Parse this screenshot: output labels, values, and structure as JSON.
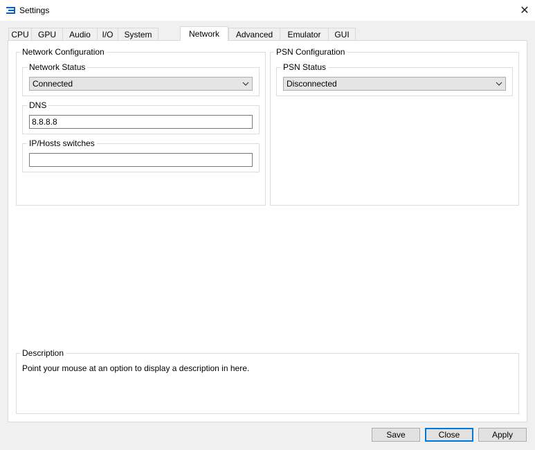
{
  "window": {
    "title": "Settings",
    "close_glyph": "✕",
    "icon": "app-logo-icon",
    "accent": "#0078d7"
  },
  "tabs": [
    {
      "label": "CPU"
    },
    {
      "label": "GPU"
    },
    {
      "label": "Audio"
    },
    {
      "label": "I/O"
    },
    {
      "label": "System"
    },
    {
      "label": "Network",
      "active": true
    },
    {
      "label": "Advanced"
    },
    {
      "label": "Emulator"
    },
    {
      "label": "GUI"
    }
  ],
  "network_config": {
    "title": "Network Configuration",
    "status": {
      "label": "Network Status",
      "value": "Connected"
    },
    "dns": {
      "label": "DNS",
      "value": "8.8.8.8"
    },
    "ip_hosts": {
      "label": "IP/Hosts switches",
      "value": ""
    }
  },
  "psn_config": {
    "title": "PSN Configuration",
    "status": {
      "label": "PSN Status",
      "value": "Disconnected"
    }
  },
  "description": {
    "title": "Description",
    "text": "Point your mouse at an option to display a description in here."
  },
  "buttons": {
    "save": "Save",
    "close": "Close",
    "apply": "Apply"
  }
}
